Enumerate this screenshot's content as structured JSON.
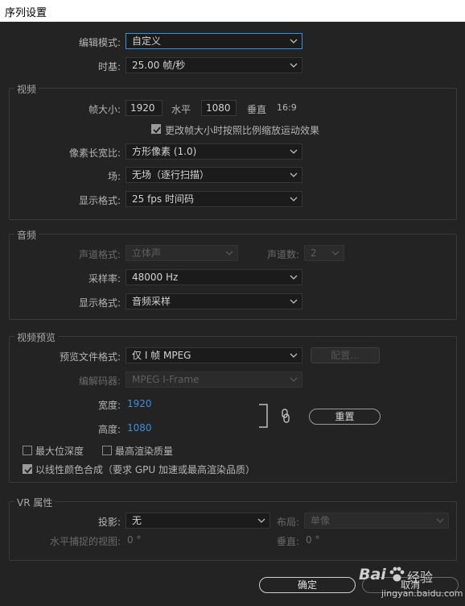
{
  "window": {
    "title": "序列设置"
  },
  "top": {
    "edit_mode_label": "编辑模式:",
    "edit_mode_value": "自定义",
    "timebase_label": "时基:",
    "timebase_value": "25.00  帧/秒"
  },
  "video": {
    "title": "视频",
    "frame_size_label": "帧大小:",
    "width_value": "1920",
    "horizontal_label": "水平",
    "height_value": "1080",
    "vertical_label": "垂直",
    "aspect": "16:9",
    "scale_checkbox_label": "更改帧大小时按照比例缩放运动效果",
    "scale_checked": true,
    "pixel_aspect_label": "像素长宽比:",
    "pixel_aspect_value": "方形像素 (1.0)",
    "field_label": "场:",
    "field_value": "无场（逐行扫描）",
    "display_format_label": "显示格式:",
    "display_format_value": "25 fps 时间码"
  },
  "audio": {
    "title": "音频",
    "channel_format_label": "声道格式:",
    "channel_format_value": "立体声",
    "channel_count_label": "声道数:",
    "channel_count_value": "2",
    "sample_rate_label": "采样率:",
    "sample_rate_value": "48000 Hz",
    "display_format_label": "显示格式:",
    "display_format_value": "音频采样"
  },
  "preview": {
    "title": "视频预览",
    "file_format_label": "预览文件格式:",
    "file_format_value": "仅 I 帧 MPEG",
    "config_button": "配置...",
    "codec_label": "编解码器:",
    "codec_value": "MPEG I-Frame",
    "width_label": "宽度:",
    "width_value": "1920",
    "height_label": "高度:",
    "height_value": "1080",
    "reset_button": "重置",
    "max_depth_label": "最大位深度",
    "max_quality_label": "最高渲染质量",
    "linear_color_label": "以线性颜色合成（要求 GPU 加速或最高渲染品质）",
    "linear_color_checked": true
  },
  "vr": {
    "title": "VR 属性",
    "projection_label": "投影:",
    "projection_value": "无",
    "layout_label": "布局:",
    "layout_value": "单像",
    "h_view_label": "水平捕捉的视图:",
    "h_view_value": "0 °",
    "v_label": "垂直:",
    "v_value": "0 °"
  },
  "footer": {
    "ok_button": "确定",
    "cancel_button": "取消"
  },
  "watermark": {
    "brand": "Bai",
    "brand2": "经验",
    "url": "jingyan.baidu.com"
  },
  "colors": {
    "accent": "#3c8ee0",
    "value_blue": "#3f8fd8",
    "background": "#232323"
  }
}
